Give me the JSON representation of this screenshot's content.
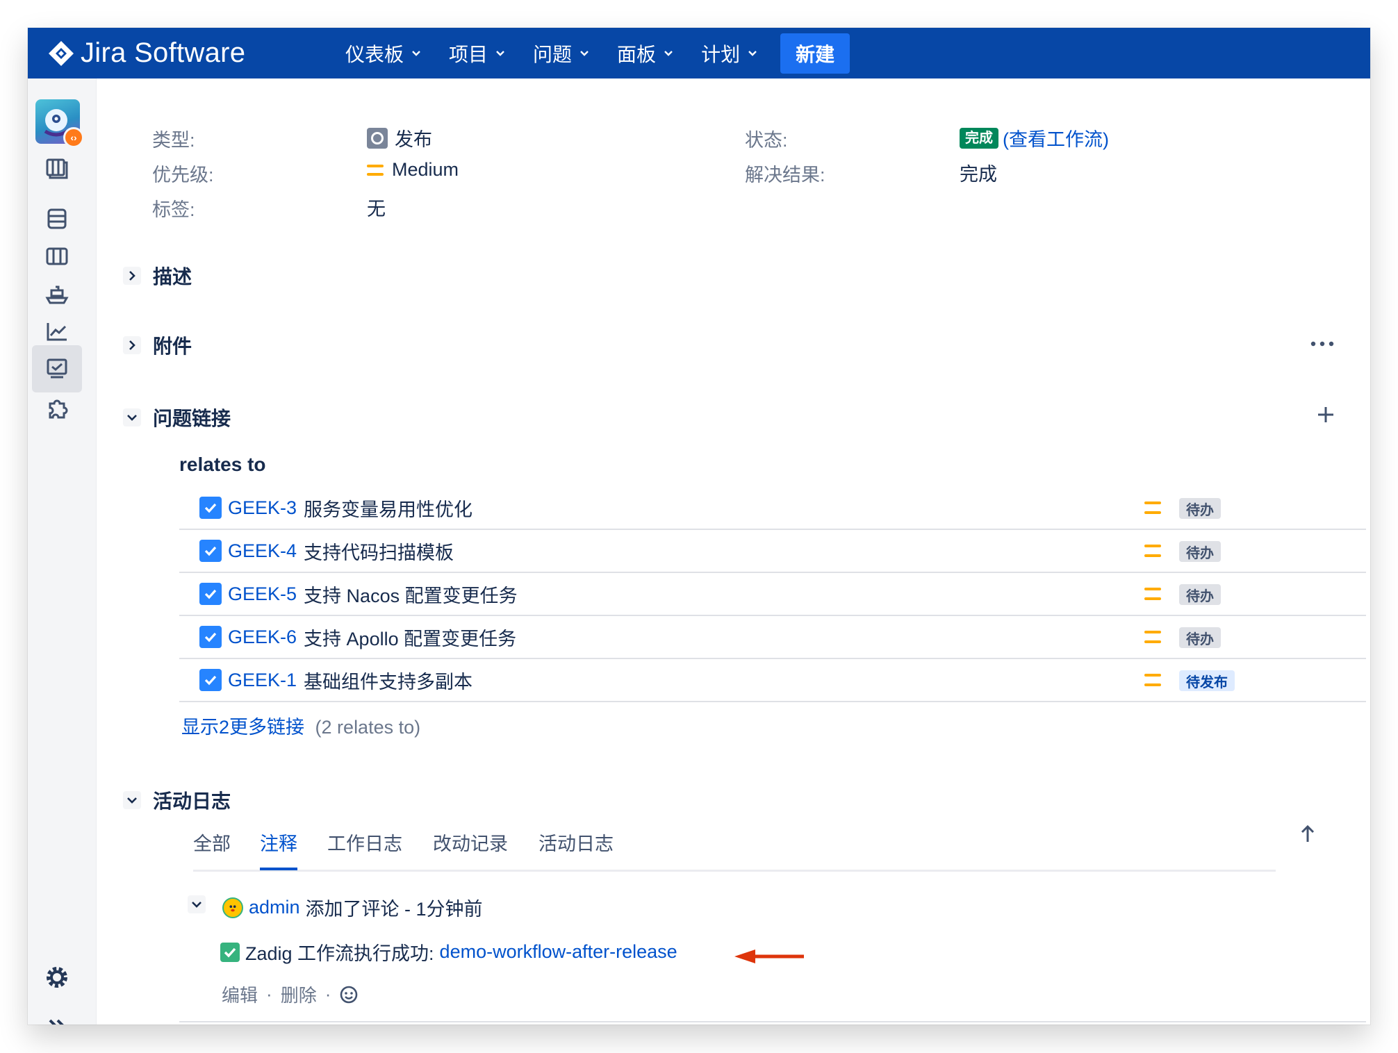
{
  "app": {
    "name": "Jira Software"
  },
  "nav": {
    "items": [
      "仪表板",
      "项目",
      "问题",
      "面板",
      "计划"
    ],
    "create": "新建"
  },
  "details": {
    "type_label": "类型:",
    "type_value": "发布",
    "priority_label": "优先级:",
    "priority_value": "Medium",
    "labels_label": "标签:",
    "labels_value": "无",
    "status_label": "状态:",
    "status_value": "完成",
    "status_link": "(查看工作流)",
    "resolution_label": "解决结果:",
    "resolution_value": "完成"
  },
  "sections": {
    "description": "描述",
    "attachments": "附件",
    "issue_links": "问题链接",
    "activity": "活动日志"
  },
  "issue_links": {
    "relation": "relates to",
    "items": [
      {
        "key": "GEEK-3",
        "summary": "服务变量易用性优化",
        "status": "待办"
      },
      {
        "key": "GEEK-4",
        "summary": "支持代码扫描模板",
        "status": "待办"
      },
      {
        "key": "GEEK-5",
        "summary": "支持 Nacos 配置变更任务",
        "status": "待办"
      },
      {
        "key": "GEEK-6",
        "summary": "支持 Apollo 配置变更任务",
        "status": "待办"
      },
      {
        "key": "GEEK-1",
        "summary": "基础组件支持多副本",
        "status": "待发布"
      }
    ],
    "show_more": "显示2更多链接",
    "show_more_note": "(2 relates to)"
  },
  "activity": {
    "tabs": [
      "全部",
      "注释",
      "工作日志",
      "改动记录",
      "活动日志"
    ],
    "active_tab": "注释",
    "comment": {
      "author": "admin",
      "action": "添加了评论 - 1分钟前",
      "text": "Zadig 工作流执行成功:",
      "link": "demo-workflow-after-release",
      "edit": "编辑",
      "delete": "删除",
      "sep": "·"
    }
  },
  "colors": {
    "topbar": "#0747a6",
    "link": "#0052cc",
    "done": "#00875a",
    "priority": "#ffab00",
    "arrow": "#de350b"
  }
}
